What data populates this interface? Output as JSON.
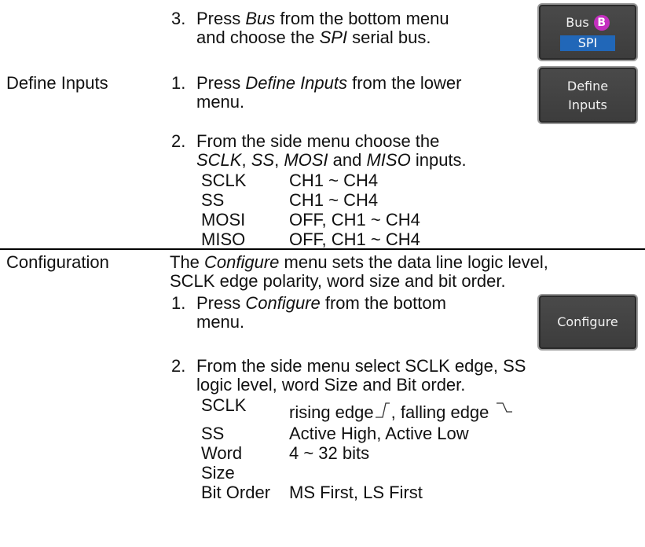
{
  "bus_step": {
    "number": "3.",
    "line1_pre": "Press ",
    "line1_em": "Bus",
    "line1_post": " from the bottom menu",
    "line2_pre": "and choose the ",
    "line2_em": "SPI",
    "line2_post": " serial bus."
  },
  "bus_button": {
    "label": "Bus",
    "badge": "B",
    "value": "SPI"
  },
  "define_inputs": {
    "side_label": "Define Inputs",
    "step1": {
      "number": "1.",
      "line1_pre": "Press ",
      "line1_em": "Define Inputs",
      "line1_post": " from the lower",
      "line2": "menu."
    },
    "button": {
      "line1": "Define",
      "line2": "Inputs"
    },
    "step2": {
      "number": "2.",
      "line1": "From the side menu choose the",
      "i1": "SCLK",
      "s1": ", ",
      "i2": "SS",
      "s2": ", ",
      "i3": "MOSI",
      "s3": " and ",
      "i4": "MISO",
      "s4": " inputs."
    },
    "table": [
      {
        "name": "SCLK",
        "value": "CH1 ~ CH4"
      },
      {
        "name": "SS",
        "value": "CH1 ~ CH4"
      },
      {
        "name": "MOSI",
        "value": "OFF, CH1 ~ CH4"
      },
      {
        "name": "MISO",
        "value": "OFF, CH1 ~ CH4"
      }
    ]
  },
  "configuration": {
    "side_label": "Configuration",
    "intro_pre": "The ",
    "intro_em": "Configure",
    "intro_post": " menu sets the data line logic level,",
    "intro_line2": "SCLK edge polarity, word size and bit order.",
    "step1": {
      "number": "1.",
      "line1_pre": "Press ",
      "line1_em": "Configure",
      "line1_post": " from the bottom",
      "line2": "menu."
    },
    "button": {
      "label": "Configure"
    },
    "step2": {
      "number": "2.",
      "line1": "From the side menu select SCLK edge, SS",
      "line2": "logic level, word Size and Bit order."
    },
    "table": {
      "sclk_name": "SCLK",
      "sclk_rising": "rising edge",
      "sclk_sep": ", falling edge",
      "ss_name": "SS",
      "ss_value": "Active High, Active Low",
      "word_name_1": "Word",
      "word_name_2": "Size",
      "word_value": "4 ~ 32 bits",
      "bit_name": "Bit Order",
      "bit_value": "MS First, LS First"
    }
  }
}
